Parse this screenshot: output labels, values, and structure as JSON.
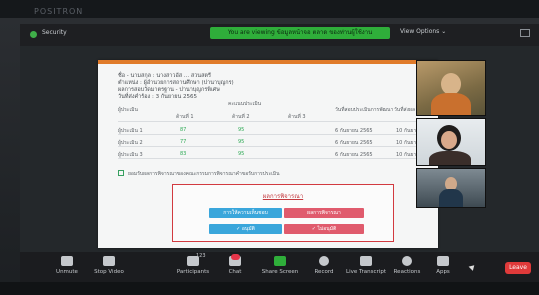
{
  "window": {
    "brand": "POSITRON",
    "meeting_id": "Security"
  },
  "banner": {
    "text": "You are viewing ข้อมูลหน้าจอ ตลาด ของท่านผู้ใช้งาน"
  },
  "view_options": {
    "label": "View Options ⌄"
  },
  "document": {
    "info": {
      "title": "ชื่อ - นามสกุล : นางสาวอัส ... สวนสตรี",
      "agency": "ตำแหน่ง : ผู้อำนวยการสถานศึกษา (ปานาบุญกร)",
      "center": "ผลการสอบวัดมาตรฐาน - ปานาบุญกรพิเศษ",
      "date": "วันที่ส่งคำร้อง : 3 กันยายน 2565"
    },
    "table": {
      "headers": {
        "col0": "ผู้ประเมิน",
        "group": "คะแนนประเมิน",
        "sub1": "ด้านที่ 1",
        "sub2": "ด้านที่ 2",
        "sub3": "ด้านที่ 3",
        "col4": "วันที่สอบประเมินการพัฒนา",
        "col5": "วันที่ส่งผล"
      },
      "rows": [
        {
          "name": "ผู้ประเมิน 1",
          "v1": "87",
          "v2": "95",
          "date": "6 กันยายน 2565",
          "date2": "10 กันยายน"
        },
        {
          "name": "ผู้ประเมิน 2",
          "v1": "77",
          "v2": "95",
          "date": "6 กันยายน 2565",
          "date2": "10 กันยายน"
        },
        {
          "name": "ผู้ประเมิน 3",
          "v1": "83",
          "v2": "95",
          "date": "6 กันยายน 2565",
          "date2": "10 กันยายน"
        }
      ]
    },
    "checkbox_label": "ยอมรับผลการพิจารณาของคณะกรรมการพิจารณาคำขอรับการประเมิน",
    "approve": {
      "title": "ผลการพิจารณา",
      "btn_primary_a": "การให้ความเห็นชอบ",
      "btn_danger_a": "ผลการพิจารณา",
      "btn_primary_b": "✓ อนุมัติ",
      "btn_danger_b": "✓ ไม่อนุมัติ"
    }
  },
  "toolbar": {
    "mute": "Unmute",
    "video": "Stop Video",
    "participants": "Participants",
    "participants_count": "123",
    "chat": "Chat",
    "share": "Share Screen",
    "record": "Record",
    "transcript": "Live Transcript",
    "reactions": "Reactions",
    "apps": "Apps",
    "leave": "Leave"
  },
  "colors": {
    "accent_green": "#2fae3a",
    "leave_red": "#e03a3a",
    "doc_orange": "#e07b2a",
    "approve_red": "#d23a40"
  }
}
